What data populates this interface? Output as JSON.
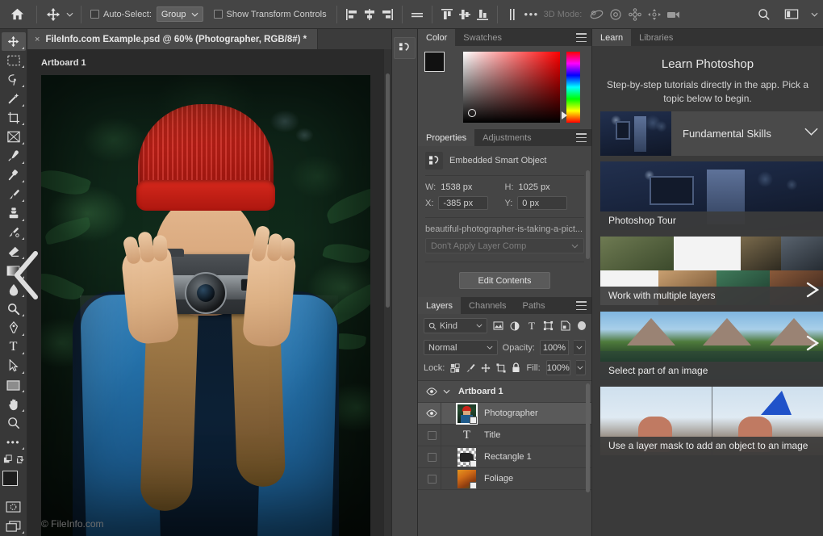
{
  "options_bar": {
    "home_icon": "home-icon",
    "tool_icon": "move-tool-icon",
    "auto_select_label": "Auto-Select:",
    "auto_select_value": "Group",
    "show_transform_label": "Show Transform Controls",
    "more_options": "•••",
    "three_d_mode_label": "3D Mode:",
    "search_icon": "search-icon",
    "arrange_icon": "arrange-documents-icon",
    "workspace_icon": "workspace-switcher-icon"
  },
  "document": {
    "tab_title": "FileInfo.com Example.psd @ 60% (Photographer, RGB/8#) *",
    "close_glyph": "×",
    "artboard_label": "Artboard 1",
    "watermark": "© FileInfo.com"
  },
  "toolbar": {
    "tools": [
      {
        "name": "move-tool",
        "active": true
      },
      {
        "name": "rectangular-marquee-tool",
        "active": false
      },
      {
        "name": "lasso-tool",
        "active": false
      },
      {
        "name": "magic-wand-tool",
        "active": false
      },
      {
        "name": "crop-tool",
        "active": false
      },
      {
        "name": "frame-tool",
        "active": false
      },
      {
        "name": "eyedropper-tool",
        "active": false
      },
      {
        "name": "spot-healing-brush-tool",
        "active": false
      },
      {
        "name": "brush-tool",
        "active": false
      },
      {
        "name": "clone-stamp-tool",
        "active": false
      },
      {
        "name": "history-brush-tool",
        "active": false
      },
      {
        "name": "eraser-tool",
        "active": false
      },
      {
        "name": "gradient-tool",
        "active": false
      },
      {
        "name": "blur-tool",
        "active": false
      },
      {
        "name": "dodge-tool",
        "active": false
      },
      {
        "name": "pen-tool",
        "active": false
      },
      {
        "name": "type-tool",
        "active": false
      },
      {
        "name": "path-selection-tool",
        "active": false
      },
      {
        "name": "rectangle-tool",
        "active": false
      },
      {
        "name": "hand-tool",
        "active": false
      },
      {
        "name": "zoom-tool",
        "active": false
      },
      {
        "name": "edit-toolbar-tool",
        "active": false
      }
    ],
    "foreground_color": "#1c1c1c",
    "background_color": "#e8a325",
    "type_tool_glyph": "T",
    "more_tools_glyph": "•••"
  },
  "color_panel": {
    "tabs": [
      {
        "label": "Color",
        "active": true
      },
      {
        "label": "Swatches",
        "active": false
      }
    ],
    "foreground_hex": "#111111",
    "background_hex": "#e2a02a",
    "field_base_hex": "#ff0000"
  },
  "properties_panel": {
    "tabs": [
      {
        "label": "Properties",
        "active": true
      },
      {
        "label": "Adjustments",
        "active": false
      }
    ],
    "object_type": "Embedded Smart Object",
    "w_label": "W:",
    "w_value": "1538 px",
    "h_label": "H:",
    "h_value": "1025 px",
    "x_label": "X:",
    "x_value": "-385 px",
    "y_label": "Y:",
    "y_value": "0 px",
    "file_name": "beautiful-photographer-is-taking-a-pict...",
    "layer_comp": "Don't Apply Layer Comp",
    "edit_contents_button": "Edit Contents"
  },
  "layers_panel": {
    "tabs": [
      {
        "label": "Layers",
        "active": true
      },
      {
        "label": "Channels",
        "active": false
      },
      {
        "label": "Paths",
        "active": false
      }
    ],
    "filter_kind": "Kind",
    "blend_mode": "Normal",
    "opacity_label": "Opacity:",
    "opacity_value": "100%",
    "lock_label": "Lock:",
    "fill_label": "Fill:",
    "fill_value": "100%",
    "layers": [
      {
        "name": "Artboard 1",
        "type": "group",
        "visible": true,
        "selected": false
      },
      {
        "name": "Photographer",
        "type": "smart-object",
        "visible": true,
        "selected": true
      },
      {
        "name": "Title",
        "type": "text",
        "visible": false,
        "selected": false
      },
      {
        "name": "Rectangle 1",
        "type": "shape",
        "visible": false,
        "selected": false
      },
      {
        "name": "Foliage",
        "type": "image",
        "visible": false,
        "selected": false
      }
    ]
  },
  "learn_panel": {
    "tabs": [
      {
        "label": "Learn",
        "active": true
      },
      {
        "label": "Libraries",
        "active": false
      }
    ],
    "title": "Learn Photoshop",
    "subtitle": "Step-by-step tutorials directly in the app. Pick a topic below to begin.",
    "category": {
      "label": "Fundamental Skills",
      "chevron": "⌄"
    },
    "cards": [
      {
        "caption": "Photoshop Tour"
      },
      {
        "caption": "Work with multiple layers"
      },
      {
        "caption": "Select part of an image"
      },
      {
        "caption": "Use a layer mask to add an object to an image"
      }
    ]
  },
  "canvas_overlay": {
    "left_chevron": "‹"
  }
}
